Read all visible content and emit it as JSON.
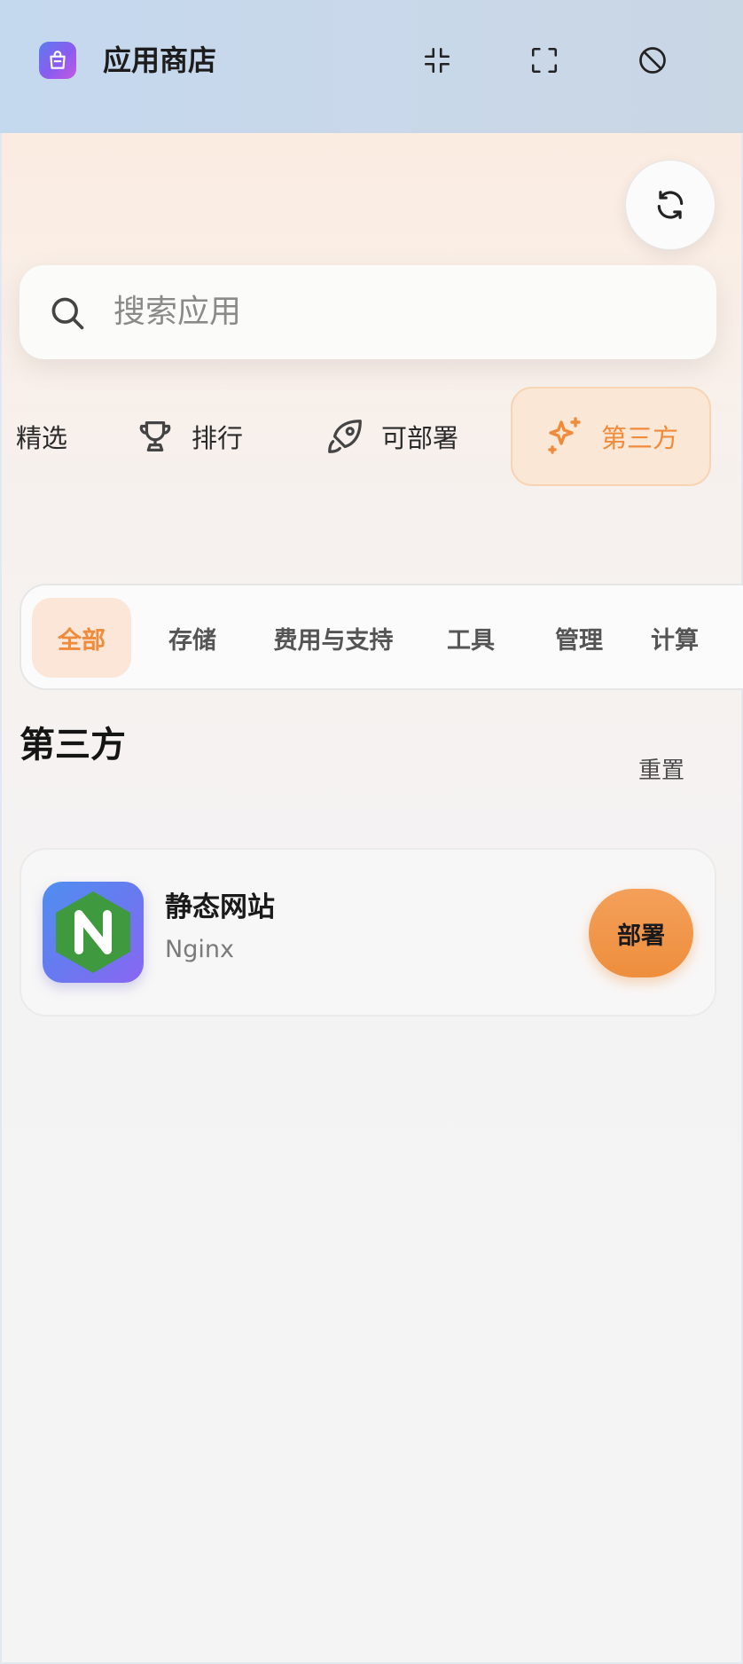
{
  "header": {
    "title": "应用商店",
    "app_icon": "shopping-bag-icon",
    "buttons": [
      "collapse-icon",
      "fullscreen-icon",
      "block-icon"
    ]
  },
  "refresh": {
    "icon": "refresh-icon"
  },
  "search": {
    "placeholder": "搜索应用",
    "icon": "search-icon"
  },
  "nav_tabs": [
    {
      "label": "精选",
      "icon": ""
    },
    {
      "label": "排行",
      "icon": "trophy-icon"
    },
    {
      "label": "可部署",
      "icon": "rocket-icon"
    },
    {
      "label": "第三方",
      "icon": "sparkle-icon",
      "active": true
    }
  ],
  "categories": [
    {
      "label": "全部",
      "active": true
    },
    {
      "label": "存储"
    },
    {
      "label": "费用与支持"
    },
    {
      "label": "工具"
    },
    {
      "label": "管理"
    },
    {
      "label": "计算"
    }
  ],
  "section": {
    "title": "第三方",
    "reset_label": "重置"
  },
  "apps": [
    {
      "name": "静态网站",
      "subtitle": "Nginx",
      "logo_letter": "N",
      "action_label": "部署"
    }
  ],
  "colors": {
    "accent": "#ef8b3a",
    "accent_bg": "#fbe6d7",
    "header_bg": "#c6d8ec",
    "nginx_green": "#3f9a3f",
    "logo_gradient": [
      "#4f8ff0",
      "#8a66f2"
    ]
  }
}
